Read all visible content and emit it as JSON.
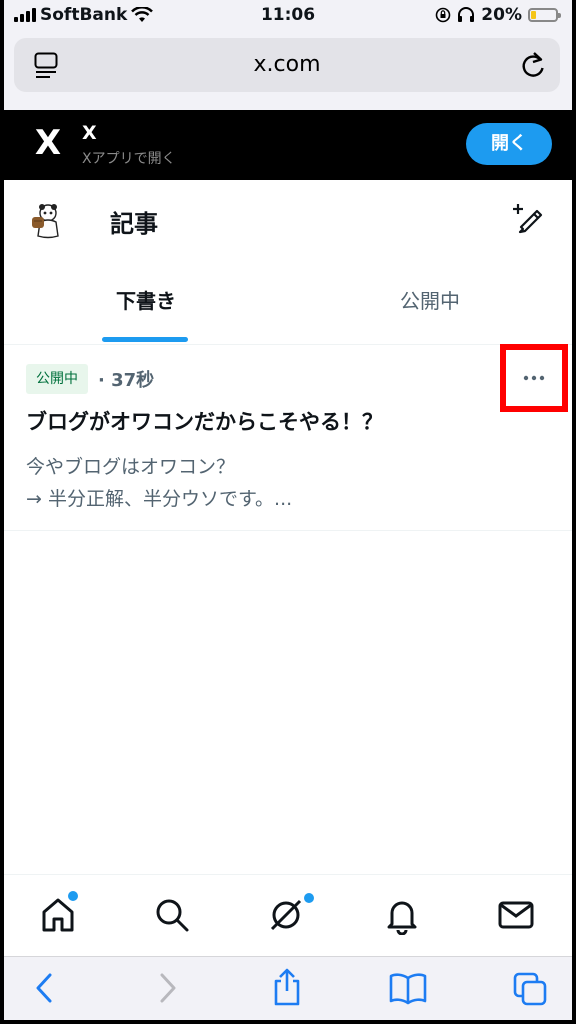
{
  "status": {
    "carrier": "SoftBank",
    "time": "11:06",
    "battery": "20%",
    "battery_level": 0.2
  },
  "browser": {
    "url": "x.com"
  },
  "app_banner": {
    "logo": "X",
    "title": "X",
    "subtitle": "Xアプリで開く",
    "open_label": "開く"
  },
  "header": {
    "title": "記事"
  },
  "tabs": [
    {
      "label": "下書き",
      "active": true
    },
    {
      "label": "公開中",
      "active": false
    }
  ],
  "articles": [
    {
      "status": "公開中",
      "age": "· 37秒",
      "title": "ブログがオワコンだからこそやる！？",
      "preview_line1": "今やブログはオワコン？",
      "preview_line2": "→ 半分正解、半分ウソです。..."
    }
  ],
  "bottom_nav": [
    "home-icon",
    "search-icon",
    "grok-icon",
    "notifications-icon",
    "messages-icon"
  ],
  "colors": {
    "accent": "#1d9bf0",
    "highlight": "#ff0000",
    "badge_bg": "#e8f6ec",
    "badge_text": "#00703c"
  }
}
